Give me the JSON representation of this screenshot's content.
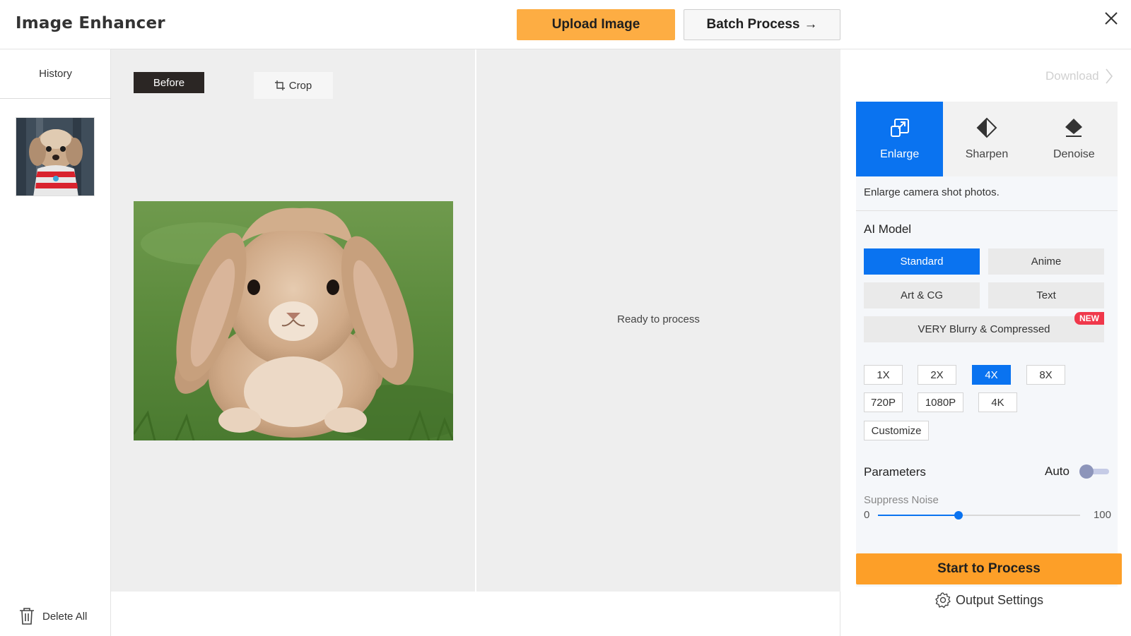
{
  "header": {
    "title": "Image Enhancer",
    "upload_label": "Upload Image",
    "batch_label": "Batch Process",
    "batch_arrow": "→"
  },
  "sidebar": {
    "history_label": "History",
    "delete_all_label": "Delete All"
  },
  "canvas": {
    "before_label": "Before",
    "crop_label": "Crop",
    "ready_text": "Ready to process"
  },
  "panel": {
    "download_label": "Download",
    "tabs": [
      {
        "label": "Enlarge",
        "icon": "enlarge-icon",
        "active": true
      },
      {
        "label": "Sharpen",
        "icon": "sharpen-icon",
        "active": false
      },
      {
        "label": "Denoise",
        "icon": "denoise-icon",
        "active": false
      }
    ],
    "description": "Enlarge camera shot photos.",
    "ai_model_label": "AI Model",
    "models": [
      {
        "label": "Standard",
        "active": true
      },
      {
        "label": "Anime",
        "active": false
      },
      {
        "label": "Art & CG",
        "active": false
      },
      {
        "label": "Text",
        "active": false
      },
      {
        "label": "VERY Blurry & Compressed",
        "active": false,
        "badge": "NEW"
      }
    ],
    "scales": [
      {
        "label": "1X",
        "active": false
      },
      {
        "label": "2X",
        "active": false
      },
      {
        "label": "4X",
        "active": true
      },
      {
        "label": "8X",
        "active": false
      },
      {
        "label": "720P",
        "active": false
      },
      {
        "label": "1080P",
        "active": false
      },
      {
        "label": "4K",
        "active": false
      },
      {
        "label": "Customize",
        "active": false
      }
    ],
    "parameters_label": "Parameters",
    "auto_label": "Auto",
    "auto_on": false,
    "suppress_noise_label": "Suppress Noise",
    "slider": {
      "min": "0",
      "max": "100",
      "value": 40
    },
    "start_label": "Start to Process",
    "output_settings_label": "Output Settings"
  },
  "colors": {
    "accent_blue": "#0a73f0",
    "upload_orange": "#fdad43",
    "start_orange": "#fd9f28",
    "new_badge_red": "#f0384b"
  }
}
